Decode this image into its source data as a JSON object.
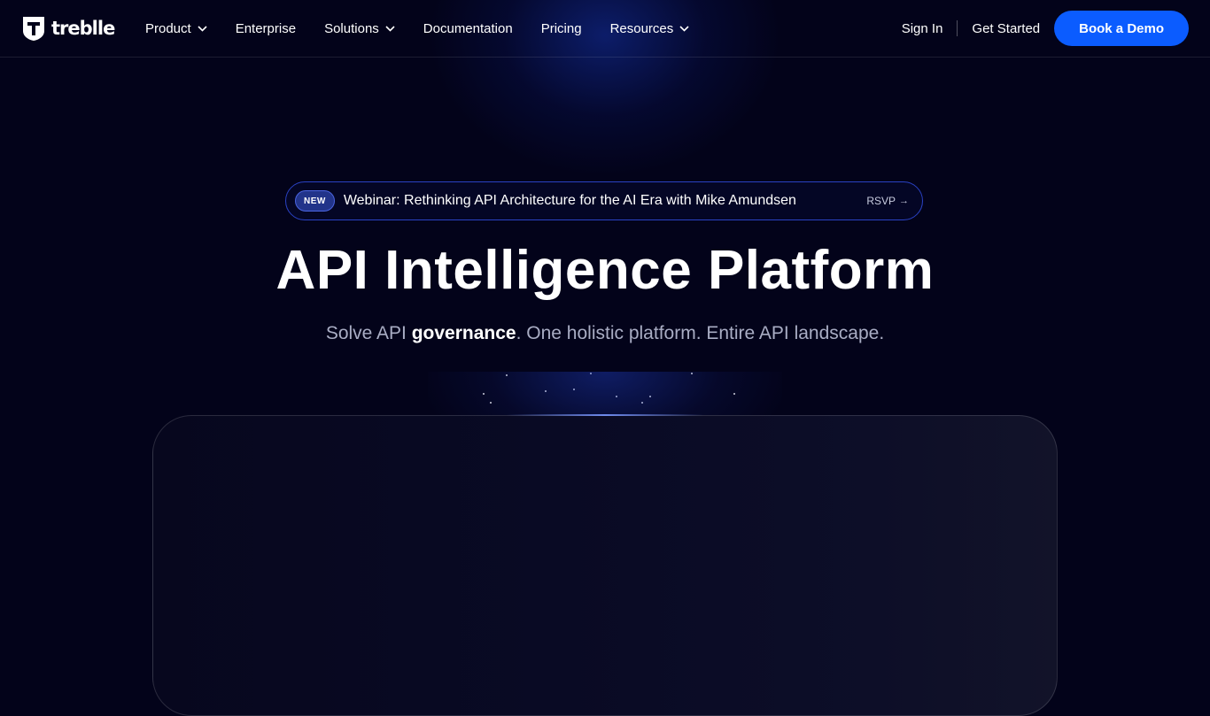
{
  "brand": {
    "name": "treblle",
    "logo_icon": "treblle-shield-logo"
  },
  "nav": {
    "items": [
      {
        "label": "Product",
        "has_dropdown": true
      },
      {
        "label": "Enterprise",
        "has_dropdown": false
      },
      {
        "label": "Solutions",
        "has_dropdown": true
      },
      {
        "label": "Documentation",
        "has_dropdown": false
      },
      {
        "label": "Pricing",
        "has_dropdown": false
      },
      {
        "label": "Resources",
        "has_dropdown": true
      }
    ],
    "sign_in": "Sign In",
    "get_started": "Get Started",
    "cta": "Book a Demo"
  },
  "announcement": {
    "badge": "NEW",
    "text": "Webinar: Rethinking API Architecture for the AI Era with Mike Amundsen",
    "action": "RSVP",
    "action_icon": "arrow-right-icon"
  },
  "hero": {
    "title": "API Intelligence Platform",
    "subtitle_before": "Solve API ",
    "subtitle_emphasis": "governance",
    "subtitle_after": ". One holistic platform. Entire API landscape."
  },
  "colors": {
    "background": "#03031a",
    "accent": "#0b5cff",
    "announcement_border": "#2a42c4",
    "subtitle": "#a9adc4"
  }
}
